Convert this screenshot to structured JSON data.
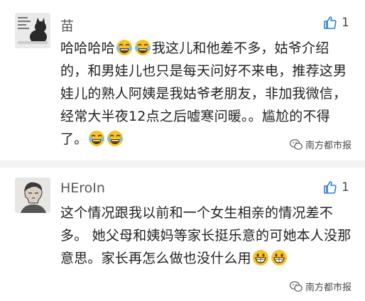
{
  "comments": [
    {
      "username": "苗",
      "likes": "1",
      "text_before": "哈哈哈哈",
      "text_after": "我这儿和他差不多，姑爷介绍的，和男娃儿也只是每天问好不来电，推荐这男娃儿的熟人阿姨是我姑爷老朋友，非加我微信，经常大半夜12点之后嘘寒问暖。。尴尬的不得了。",
      "emoji": "tears-of-joy"
    },
    {
      "username": "HEroIn",
      "likes": "1",
      "text": "这个情况跟我以前和一个女生相亲的情况差不多。 她父母和姨妈等家长挺乐意的可她本人没那意思。家长再怎么做也没什么用",
      "emoji": "grinning"
    }
  ],
  "watermark": {
    "text": "南方都市报",
    "icon": "wechat-logo-icon"
  },
  "colors": {
    "background": "#f2f2f2",
    "card": "#ffffff",
    "like_icon": "#2b7fd6"
  }
}
